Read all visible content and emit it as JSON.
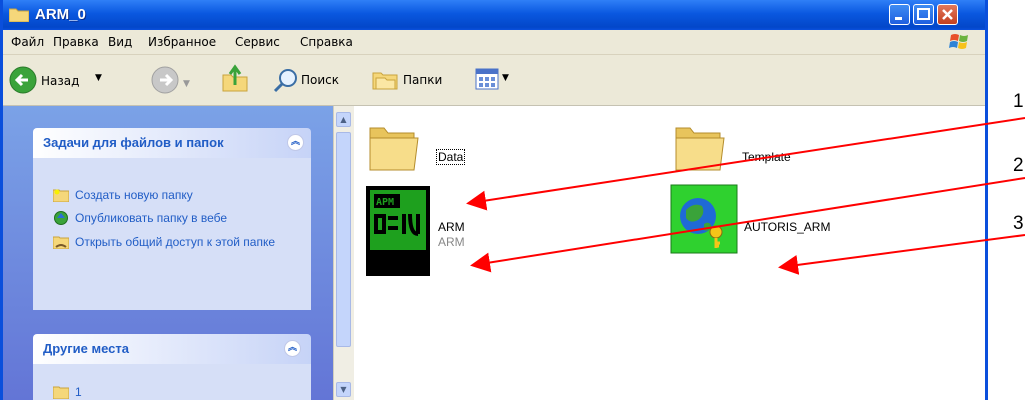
{
  "window": {
    "title": "ARM_0"
  },
  "menu": [
    "Файл",
    "Правка",
    "Вид",
    "Избранное",
    "Сервис",
    "Справка"
  ],
  "toolbar": {
    "back_label": "Назад",
    "search_label": "Поиск",
    "folders_label": "Папки"
  },
  "sidebar": {
    "tasks_panel": {
      "title": "Задачи для файлов и папок",
      "items": [
        "Создать новую папку",
        "Опубликовать папку в вебе",
        "Открыть общий доступ к этой папке"
      ]
    },
    "places_panel": {
      "title": "Другие места",
      "items": [
        "1"
      ]
    }
  },
  "files": [
    {
      "name": "Data",
      "icon": "folder-icon"
    },
    {
      "name": "Template",
      "icon": "folder-icon"
    },
    {
      "name": "ARM",
      "subtitle": "ARM",
      "icon": "arm-app-icon"
    },
    {
      "name": "AUTORIS_ARM",
      "icon": "autoris-app-icon"
    }
  ],
  "annotations": [
    "1",
    "2",
    "3"
  ],
  "colors": {
    "titlebar": "#0a58e0",
    "sidebar": "#6f8fdf",
    "task_link": "#215dc6",
    "arrow": "#ff0000"
  }
}
